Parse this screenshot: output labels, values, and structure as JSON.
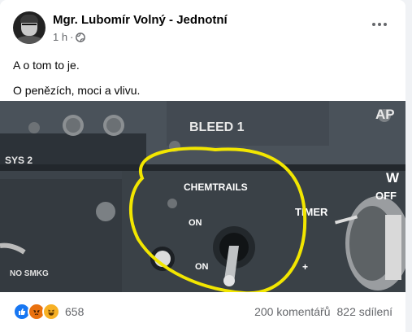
{
  "post": {
    "author": "Mgr. Lubomír Volný - Jednotní",
    "time": "1 h",
    "separator": "·",
    "privacy_icon": "globe-icon",
    "text_lines": [
      "A o tom to je.",
      "O penězích, moci a vlivu."
    ]
  },
  "image": {
    "labels": {
      "bleed": "BLEED 1",
      "ap": "AP",
      "sys2": "SYS 2",
      "chemtrails": "CHEMTRAILS",
      "on1": "ON",
      "on2": "ON",
      "timer": "TIMER",
      "off": "OFF",
      "no_smkg": "NO SMKG",
      "plus": "+",
      "w": "W"
    }
  },
  "footer": {
    "reaction_icons": [
      "like-icon",
      "angry-icon",
      "haha-icon"
    ],
    "reaction_count": "658",
    "comments": "200 komentářů",
    "shares": "822 sdílení"
  },
  "colors": {
    "like": "#1877f2",
    "angry": "#e9710f",
    "haha": "#f7b125",
    "highlight": "#f2e600"
  }
}
